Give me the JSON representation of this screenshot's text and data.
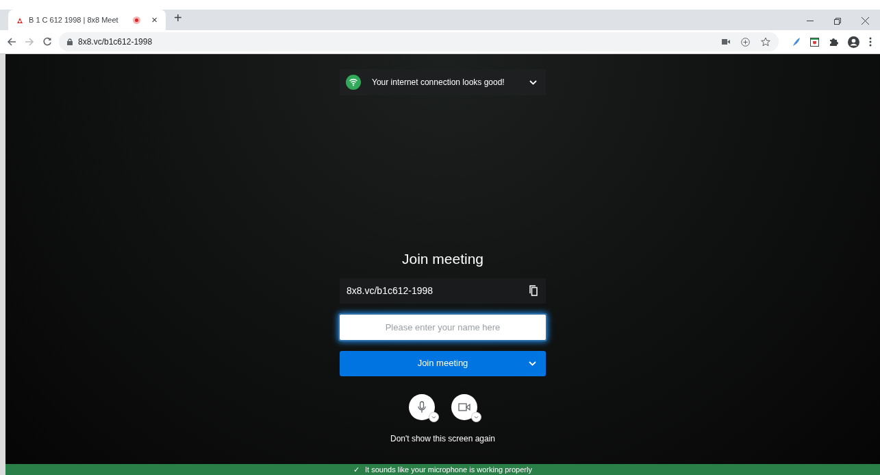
{
  "browser": {
    "tab": {
      "title": "B 1 C 612 1998 | 8x8 Meet",
      "recording": true,
      "close": "×"
    },
    "new_tab": "+",
    "address": "8x8.vc/b1c612-1998"
  },
  "connection_notice": {
    "text": "Your internet connection looks good!",
    "expanded": false
  },
  "join": {
    "title": "Join meeting",
    "meeting_link": "8x8.vc/b1c612-1998",
    "name_field": {
      "placeholder": "Please enter your name here",
      "focused": true
    },
    "button": "Join meeting",
    "dont_show": "Don't show this screen again"
  },
  "banner": {
    "icon": "✓",
    "text": "It sounds like your microphone is working properly"
  }
}
